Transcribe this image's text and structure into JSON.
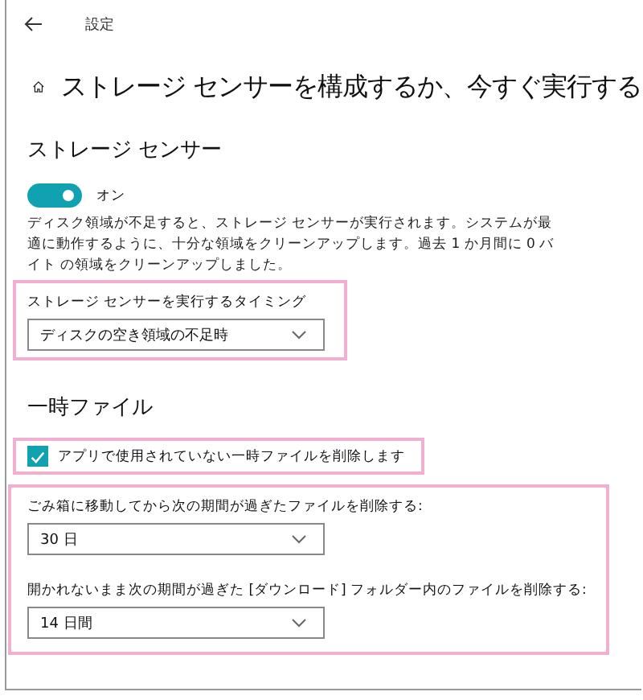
{
  "window": {
    "title": "設定"
  },
  "header": {
    "title": "ストレージ センサーを構成するか、今すぐ実行する"
  },
  "storage_sense": {
    "heading": "ストレージ センサー",
    "toggle": {
      "on": true,
      "label": "オン"
    },
    "description": "ディスク領域が不足すると、ストレージ センサーが実行されます。システムが最適に動作するように、十分な領域をクリーンアップします。過去 1 か月間に 0 バイト の領域をクリーンアップしました。",
    "timing": {
      "highlighted": true,
      "label": "ストレージ センサーを実行するタイミング",
      "value": "ディスクの空き領域の不足時"
    }
  },
  "temporary_files": {
    "heading": "一時ファイル",
    "checkbox": {
      "highlighted": true,
      "checked": true,
      "label": "アプリで使用されていない一時ファイルを削除します"
    },
    "schedules": {
      "highlighted": true,
      "items": [
        {
          "label": "ごみ箱に移動してから次の期間が過ぎたファイルを削除する:",
          "value": "30 日"
        },
        {
          "label": "開かれないまま次の期間が過ぎた [ダウンロード] フォルダー内のファイルを削除する:",
          "value": "14 日間"
        }
      ]
    }
  }
}
